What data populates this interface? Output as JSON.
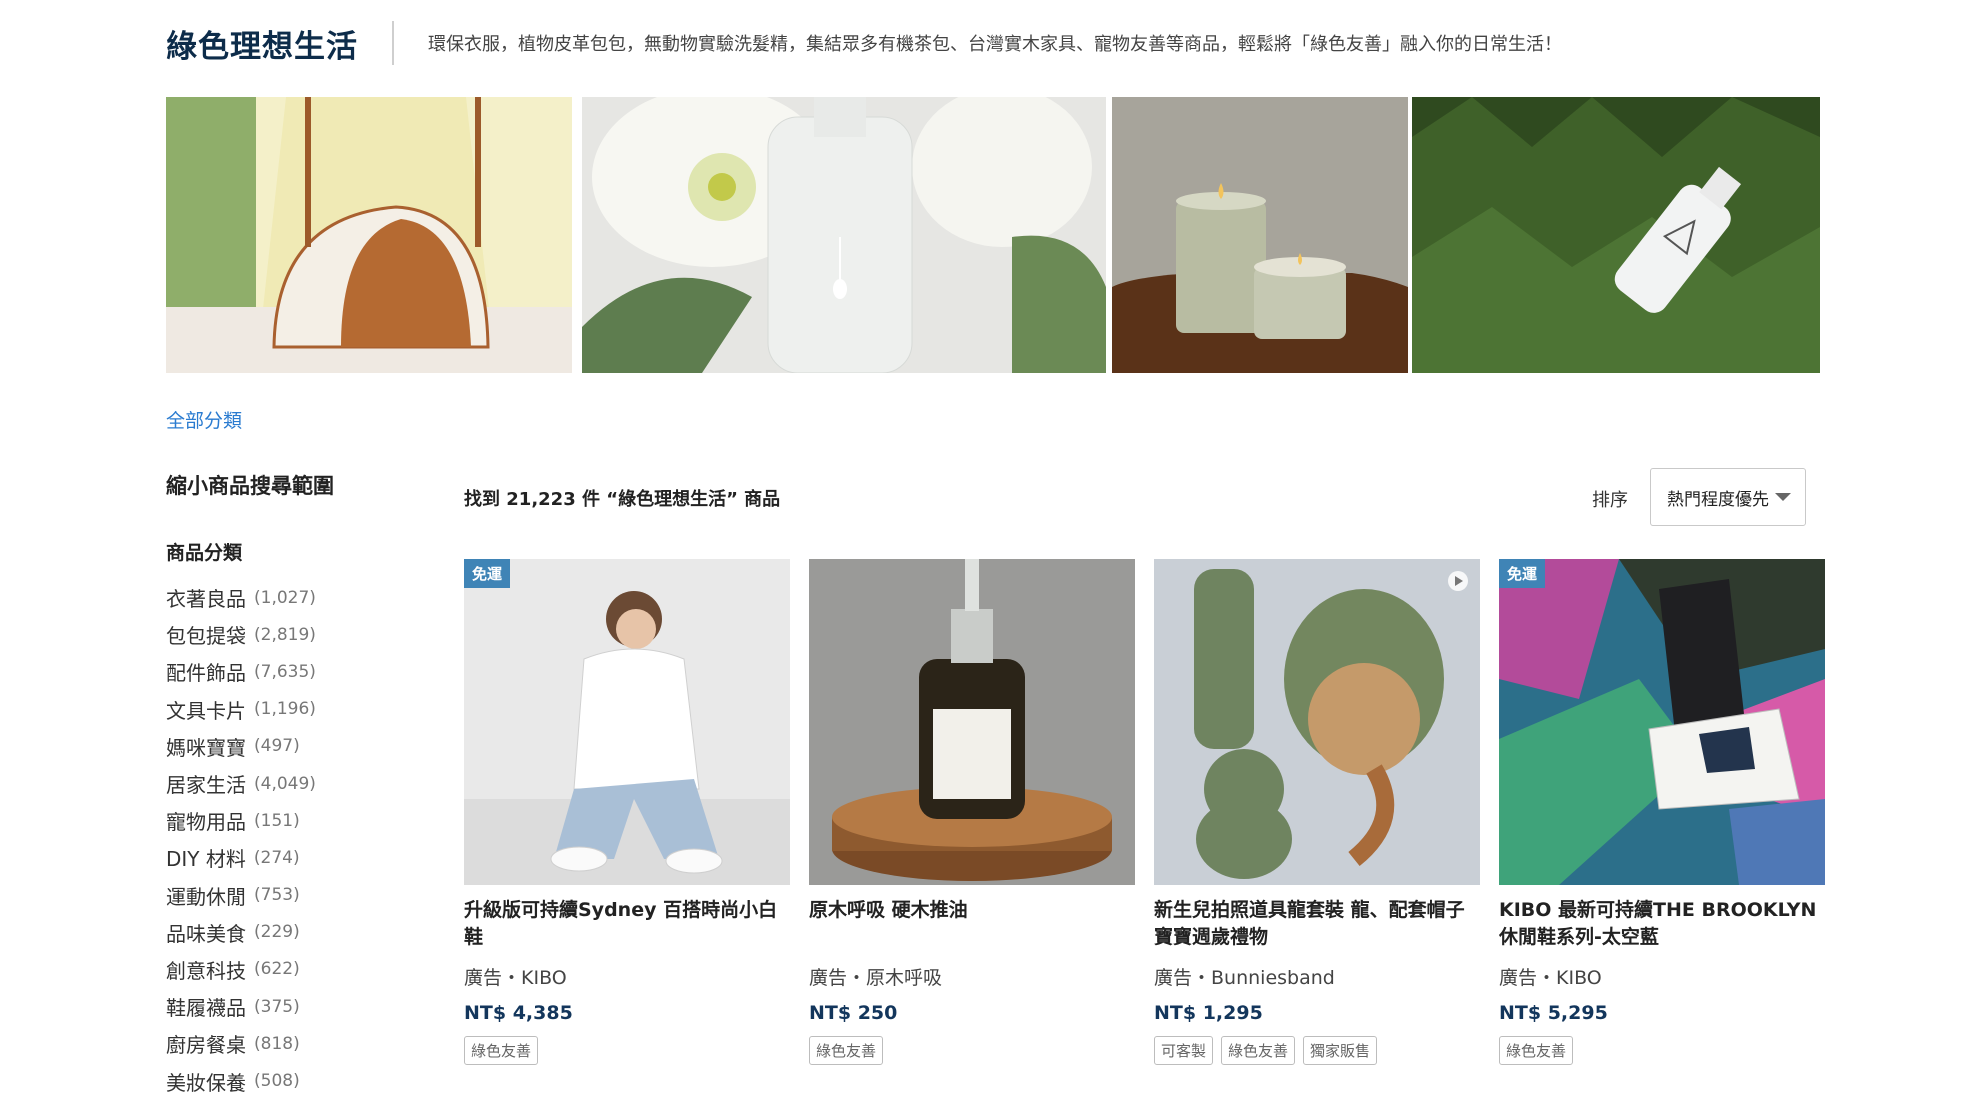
{
  "header": {
    "title": "綠色理想生活",
    "subtitle": "環保衣服，植物皮革包包，無動物實驗洗髮精，集結眾多有機茶包、台灣實木家具、寵物友善等商品，輕鬆將「綠色友善」融入你的日常生活！"
  },
  "breadcrumb": "全部分類",
  "sidebar": {
    "heading": "縮小商品搜尋範圍",
    "section": "商品分類",
    "categories": [
      {
        "label": "衣著良品",
        "count": "(1,027)"
      },
      {
        "label": "包包提袋",
        "count": "(2,819)"
      },
      {
        "label": "配件飾品",
        "count": "(7,635)"
      },
      {
        "label": "文具卡片",
        "count": "(1,196)"
      },
      {
        "label": "媽咪寶寶",
        "count": "(497)"
      },
      {
        "label": "居家生活",
        "count": "(4,049)"
      },
      {
        "label": "寵物用品",
        "count": "(151)"
      },
      {
        "label": "DIY 材料",
        "count": "(274)"
      },
      {
        "label": "運動休閒",
        "count": "(753)"
      },
      {
        "label": "品味美食",
        "count": "(229)"
      },
      {
        "label": "創意科技",
        "count": "(622)"
      },
      {
        "label": "鞋履襪品",
        "count": "(375)"
      },
      {
        "label": "廚房餐桌",
        "count": "(818)"
      },
      {
        "label": "美妝保養",
        "count": "(508)"
      }
    ]
  },
  "results": {
    "found_text": "找到 21,223 件 “綠色理想生活” 商品",
    "sort_label": "排序",
    "sort_value": "熱門程度優先"
  },
  "products": [
    {
      "badge": "免運",
      "name": "升級版可持續Sydney 百搭時尚小白鞋",
      "shop": "廣告・KIBO",
      "price": "NT$ 4,385",
      "tags": [
        "綠色友善"
      ],
      "video": false
    },
    {
      "badge": "",
      "name": "原木呼吸 硬木推油",
      "shop": "廣告・原木呼吸",
      "price": "NT$ 250",
      "tags": [
        "綠色友善"
      ],
      "video": false
    },
    {
      "badge": "",
      "name": "新生兒拍照道具龍套裝 龍、配套帽子 寶寶週歲禮物",
      "shop": "廣告・Bunniesband",
      "price": "NT$ 1,295",
      "tags": [
        "可客製",
        "綠色友善",
        "獨家販售"
      ],
      "video": true
    },
    {
      "badge": "免運",
      "name": "KIBO 最新可持續THE BROOKLYN 休閒鞋系列-太空藍",
      "shop": "廣告・KIBO",
      "price": "NT$ 5,295",
      "tags": [
        "綠色友善"
      ],
      "video": false
    }
  ],
  "icons": {
    "sort_caret": "chevron-down-icon",
    "video": "play-icon"
  },
  "colors": {
    "title": "#0d2c4a",
    "link": "#2a7bd0",
    "price": "#13365c",
    "badge": "#3f84b6"
  }
}
